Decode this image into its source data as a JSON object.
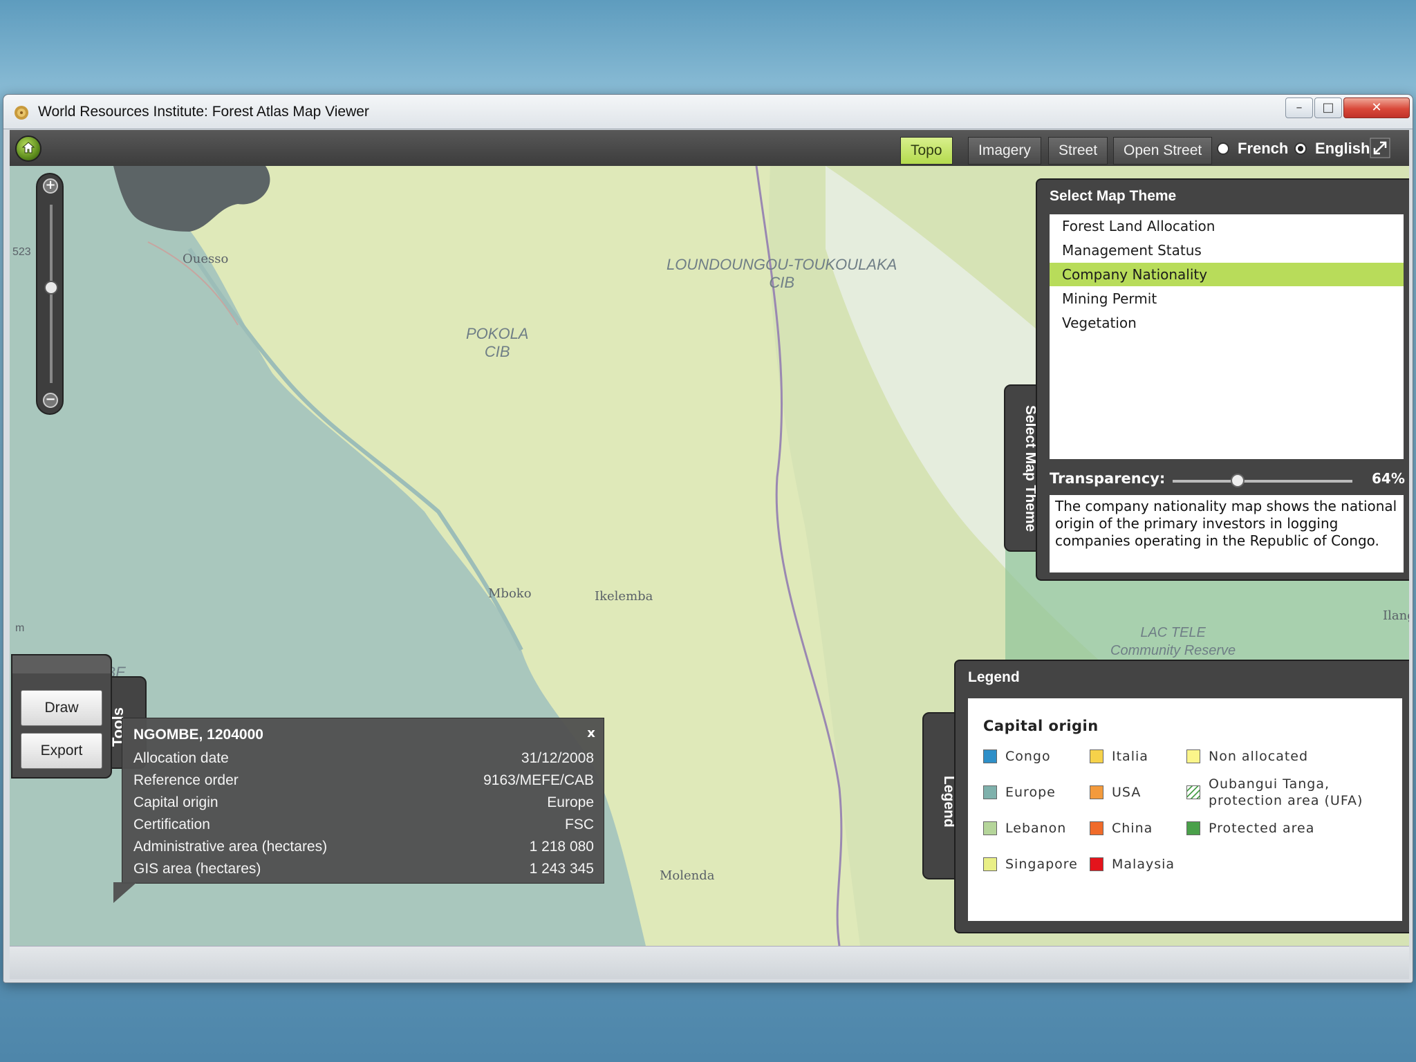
{
  "window": {
    "title": "World Resources Institute: Forest Atlas Map Viewer",
    "controls": {
      "minimize": "–",
      "maximize": "□",
      "close": "✕"
    }
  },
  "toolbar": {
    "basemaps": [
      "Topo",
      "Imagery",
      "Street",
      "Open Street"
    ],
    "active_basemap": "Topo",
    "languages": [
      {
        "label": "French",
        "selected": false
      },
      {
        "label": "English",
        "selected": true
      }
    ]
  },
  "map": {
    "scale_label": "523",
    "scale_unit": "m",
    "region_labels": [
      {
        "text": "POKOLA\nCIB"
      },
      {
        "text": "LOUNDOUNGOU-TOUKOULAKA\nCIB"
      },
      {
        "text": "NGOMBE\nIFO"
      },
      {
        "text": "LAC TELE\nCommunity Reserve"
      }
    ],
    "towns": [
      "Ouesso",
      "Mboko",
      "Ikelemba",
      "Molenda",
      "Ilang"
    ]
  },
  "tools": {
    "tab_label": "Tools",
    "buttons": [
      "Draw",
      "Export"
    ]
  },
  "theme_panel": {
    "tab_label": "Select Map Theme",
    "title": "Select Map Theme",
    "themes": [
      "Forest Land Allocation",
      "Management Status",
      "Company Nationality",
      "Mining Permit",
      "Vegetation"
    ],
    "selected_theme": "Company Nationality",
    "transparency_label": "Transparency:",
    "transparency_value": "64%",
    "transparency_level": 0.36,
    "description": "The company nationality map shows the national origin of the primary investors in logging companies operating in the Republic of Congo."
  },
  "legend": {
    "tab_label": "Legend",
    "title": "Legend",
    "heading": "Capital origin",
    "items": [
      {
        "label": "Congo",
        "color": "#2e8fc8"
      },
      {
        "label": "Italia",
        "color": "#f6d24a"
      },
      {
        "label": "Non allocated",
        "color": "#fbf58a"
      },
      {
        "label": "Europe",
        "color": "#7fb1ac"
      },
      {
        "label": "USA",
        "color": "#f39a3c"
      },
      {
        "label": "Oubangui Tanga, protection area (UFA)",
        "color": "hatch"
      },
      {
        "label": "Lebanon",
        "color": "#b5d59a"
      },
      {
        "label": "China",
        "color": "#f06b2a"
      },
      {
        "label": "Protected area",
        "color": "#4aa04a"
      },
      {
        "label": "Singapore",
        "color": "#e9ef86"
      },
      {
        "label": "Malaysia",
        "color": "#e4141c"
      }
    ]
  },
  "info_popup": {
    "title": "NGOMBE, 1204000",
    "close": "x",
    "rows": [
      {
        "key": "Allocation date",
        "value": "31/12/2008"
      },
      {
        "key": "Reference order",
        "value": "9163/MEFE/CAB"
      },
      {
        "key": "Capital origin",
        "value": "Europe"
      },
      {
        "key": "Certification",
        "value": "FSC"
      },
      {
        "key": "Administrative area (hectares)",
        "value": "1 218 080"
      },
      {
        "key": "GIS area (hectares)",
        "value": "1 243 345"
      }
    ]
  }
}
